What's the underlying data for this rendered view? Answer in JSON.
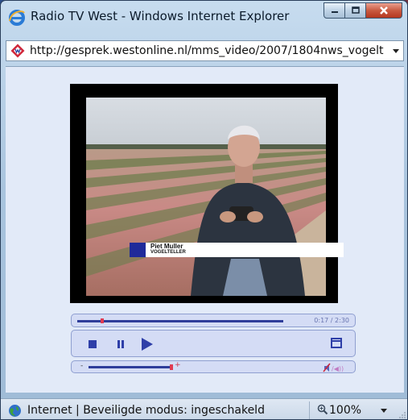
{
  "window": {
    "title": "Radio TV West - Windows Internet Explorer"
  },
  "address": {
    "url": "http://gesprek.westonline.nl/mms_video/2007/1804nws_vogelte"
  },
  "video": {
    "caption_name": "Piet Muller",
    "caption_role": "VOGELTELLER"
  },
  "player": {
    "time": "0:17 / 2:30",
    "progress_fraction": 0.113,
    "volume_fraction": 0.82,
    "volume_minus": "-",
    "volume_plus": "+"
  },
  "status": {
    "text": "Internet | Beveiligde modus: ingeschakeld",
    "zoom": "100%"
  },
  "colors": {
    "accent": "#2f3fa8",
    "marker": "#e03b52"
  },
  "icons": [
    "ie-logo-icon",
    "minimize-icon",
    "maximize-icon",
    "close-icon",
    "favicon-icon",
    "stop-icon",
    "pause-icon",
    "play-icon",
    "fullscreen-icon",
    "speaker-icon",
    "globe-icon",
    "zoom-icon"
  ]
}
